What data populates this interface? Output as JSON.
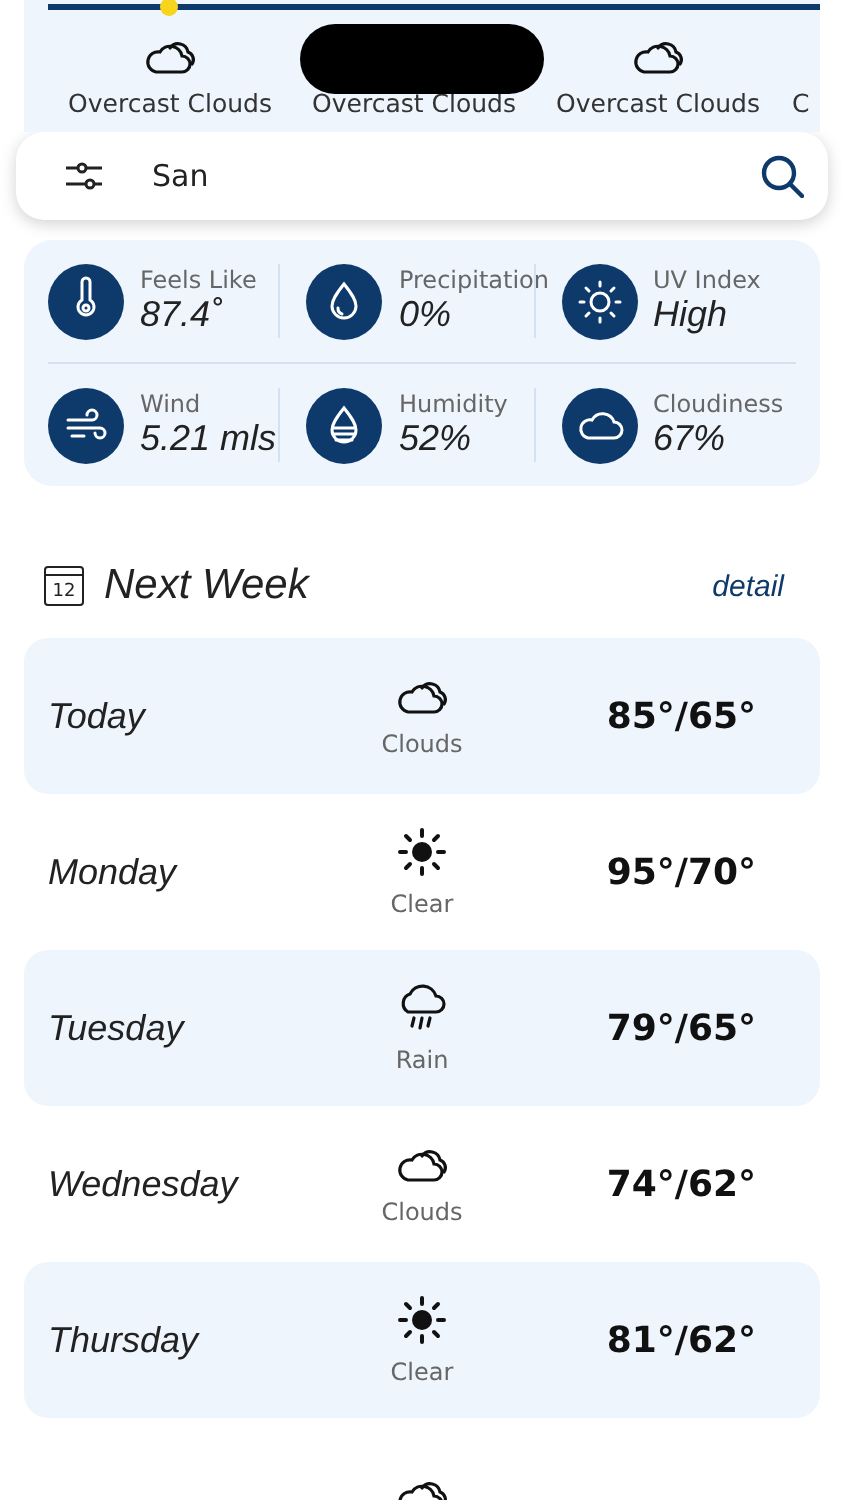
{
  "hourly": [
    {
      "kind": "clouds",
      "label": "Overcast Clouds"
    },
    {
      "label": "Overcast Clouds"
    },
    {
      "kind": "clouds",
      "label": "Overcast Clouds"
    },
    {
      "label": "C"
    }
  ],
  "search": {
    "value": "San"
  },
  "stats": [
    {
      "kind": "thermometer",
      "label": "Feels Like",
      "value": "87.4˚"
    },
    {
      "kind": "drop",
      "label": "Precipitation",
      "value": "0%"
    },
    {
      "kind": "sun",
      "label": "UV Index",
      "value": "High"
    },
    {
      "kind": "wind",
      "label": "Wind",
      "value": "5.21 mls"
    },
    {
      "kind": "humidity",
      "label": "Humidity",
      "value": "52%"
    },
    {
      "kind": "cloud",
      "label": "Cloudiness",
      "value": "67%"
    }
  ],
  "next_week": {
    "title": "Next Week",
    "calendar_day": "12",
    "link": "detail"
  },
  "days": [
    {
      "day": "Today",
      "kind": "clouds",
      "condition": "Clouds",
      "temps": "85°/65°"
    },
    {
      "day": "Monday",
      "kind": "clear",
      "condition": "Clear",
      "temps": "95°/70°"
    },
    {
      "day": "Tuesday",
      "kind": "rain",
      "condition": "Rain",
      "temps": "79°/65°"
    },
    {
      "day": "Wednesday",
      "kind": "clouds",
      "condition": "Clouds",
      "temps": "74°/62°"
    },
    {
      "day": "Thursday",
      "kind": "clear",
      "condition": "Clear",
      "temps": "81°/62°"
    },
    {
      "kind": "clouds"
    }
  ]
}
